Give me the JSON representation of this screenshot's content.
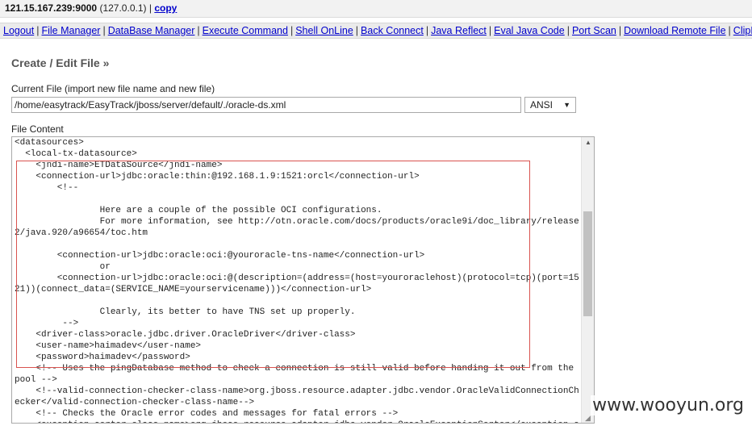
{
  "topbar": {
    "host": "121.15.167.239:9000",
    "ip": "(127.0.0.1)",
    "separator": "|",
    "copy_label": "copy"
  },
  "nav": {
    "items": [
      "Logout",
      "File Manager",
      "DataBase Manager",
      "Execute Command",
      "Shell OnLine",
      "Back Connect",
      "Java Reflect",
      "Eval Java Code",
      "Port Scan",
      "Download Remote File",
      "ClipBoard"
    ]
  },
  "page": {
    "heading": "Create / Edit File »",
    "current_file_label": "Current File (import new file name and new file)",
    "current_file_value": "/home/easytrack/EasyTrack/jboss/server/default/./oracle-ds.xml",
    "encoding": "ANSI",
    "file_content_label": "File Content"
  },
  "code_lines": [
    "<datasources>",
    "  <local-tx-datasource>",
    "    <jndi-name>ETDataSource</jndi-name>",
    "    <connection-url>jdbc:oracle:thin:@192.168.1.9:1521:orcl</connection-url>",
    "        <!--",
    "",
    "                Here are a couple of the possible OCI configurations.",
    "                For more information, see http://otn.oracle.com/docs/products/oracle9i/doc_library/release",
    "2/java.920/a96654/toc.htm",
    "",
    "        <connection-url>jdbc:oracle:oci:@youroracle-tns-name</connection-url>",
    "                or",
    "        <connection-url>jdbc:oracle:oci:@(description=(address=(host=youroraclehost)(protocol=tcp)(port=15",
    "21))(connect_data=(SERVICE_NAME=yourservicename)))</connection-url>",
    "",
    "                Clearly, its better to have TNS set up properly.",
    "         -->",
    "    <driver-class>oracle.jdbc.driver.OracleDriver</driver-class>",
    "    <user-name>haimadev</user-name>",
    "    <password>haimadev</password>",
    "    <!-- Uses the pingDatabase method to check a connection is still valid before handing it out from the",
    "pool -->",
    "    <!--valid-connection-checker-class-name>org.jboss.resource.adapter.jdbc.vendor.OracleValidConnectionCh",
    "ecker</valid-connection-checker-class-name-->",
    "    <!-- Checks the Oracle error codes and messages for fatal errors -->",
    "    <exception-sorter-class-name>org.jboss.resource.adapter.jdbc.vendor.OracleExceptionSorter</exception-s"
  ],
  "watermark": "www.wooyun.org",
  "colors": {
    "link": "#0000cc",
    "highlight_box": "#d9534f"
  }
}
